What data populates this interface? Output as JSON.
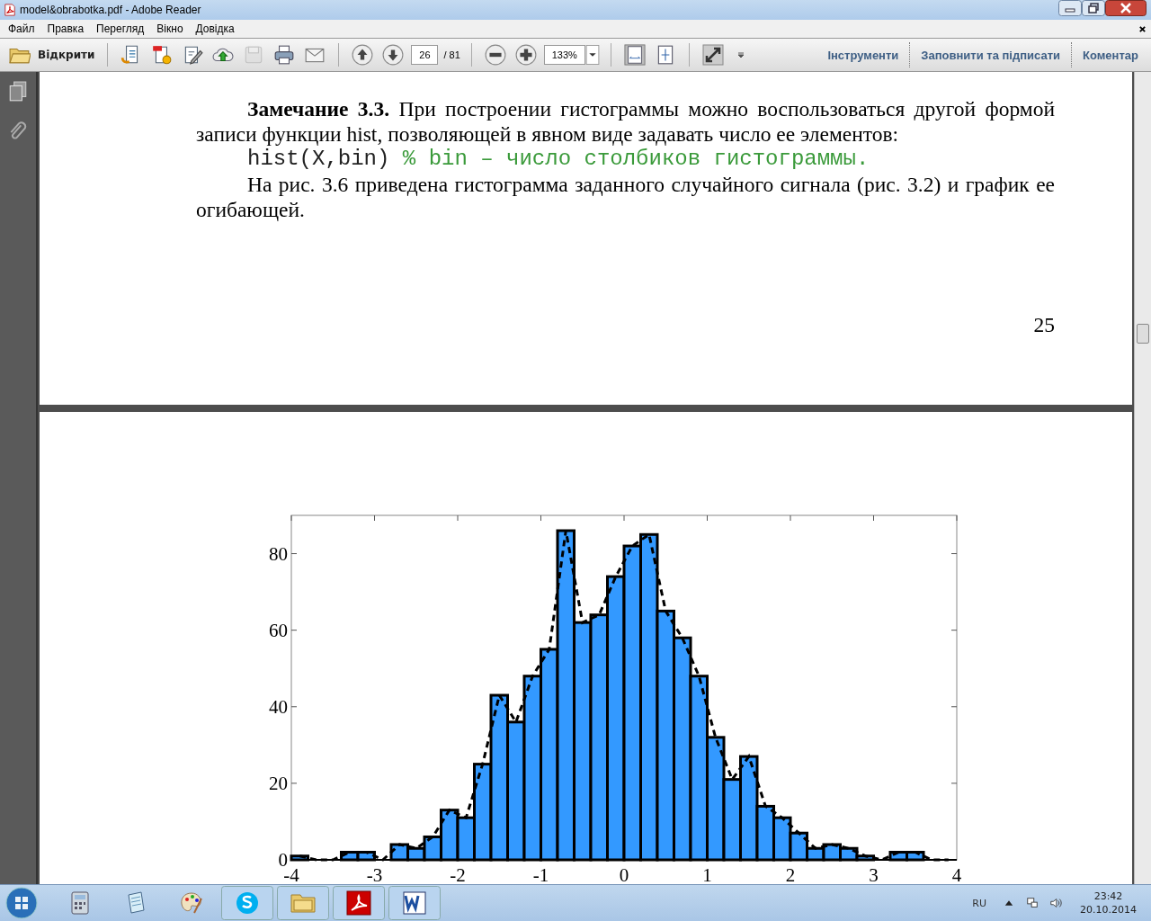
{
  "window": {
    "title": "model&obrabotka.pdf - Adobe Reader"
  },
  "menu": [
    "Файл",
    "Правка",
    "Перегляд",
    "Вікно",
    "Довідка"
  ],
  "toolbar": {
    "open_label": "Відкрити",
    "page_number": "26",
    "page_count": "/ 81",
    "zoom": "133%",
    "panels": [
      "Інструменти",
      "Заповнити та підписати",
      "Коментар"
    ]
  },
  "page_top": {
    "remark": "**Замечание 3.3.** При построении гистограммы можно воспользоваться другой формой записи функции hist, позволяющей в явном виде задавать число ее элементов:",
    "code": "hist(X,bin)",
    "comment": "% bin – число столбиков гистограммы.",
    "paragraph": "На рис. 3.6 приведена гистограмма заданного случайного сигнала (рис. 3.2) и график ее огибающей.",
    "page_number": "25"
  },
  "page_bottom": {
    "chart_data": {
      "type": "bar",
      "x": [
        -3.9,
        -3.7,
        -3.5,
        -3.3,
        -3.1,
        -2.9,
        -2.7,
        -2.5,
        -2.3,
        -2.1,
        -1.9,
        -1.7,
        -1.5,
        -1.3,
        -1.1,
        -0.9,
        -0.7,
        -0.5,
        -0.3,
        -0.1,
        0.1,
        0.3,
        0.5,
        0.7,
        0.9,
        1.1,
        1.3,
        1.5,
        1.7,
        1.9,
        2.1,
        2.3,
        2.5,
        2.7,
        2.9,
        3.1,
        3.3,
        3.5,
        3.7,
        3.9
      ],
      "values": [
        1,
        0,
        0,
        2,
        2,
        0,
        4,
        3,
        6,
        13,
        11,
        25,
        43,
        36,
        48,
        55,
        86,
        62,
        64,
        74,
        82,
        85,
        65,
        58,
        48,
        32,
        21,
        27,
        14,
        11,
        7,
        3,
        4,
        3,
        1,
        0,
        2,
        2,
        0,
        0
      ],
      "xlim": [
        -4,
        4
      ],
      "ylim": [
        0,
        90
      ],
      "xticks": [
        -4,
        -3,
        -2,
        -1,
        0,
        1,
        2,
        3,
        4
      ],
      "yticks": [
        0,
        20,
        40,
        60,
        80
      ]
    }
  },
  "taskbar": {
    "language": "RU",
    "time": "23:42",
    "date": "20.10.2014"
  }
}
